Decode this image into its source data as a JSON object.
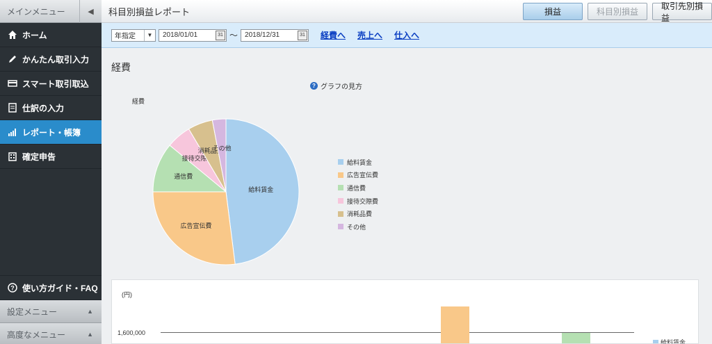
{
  "sidebar": {
    "header": "メインメニュー",
    "items": [
      {
        "label": "ホーム",
        "icon": "home-icon"
      },
      {
        "label": "かんたん取引入力",
        "icon": "pencil-icon"
      },
      {
        "label": "スマート取引取込",
        "icon": "card-icon"
      },
      {
        "label": "仕訳の入力",
        "icon": "document-icon"
      },
      {
        "label": "レポート・帳簿",
        "icon": "chart-icon",
        "active": true
      },
      {
        "label": "確定申告",
        "icon": "building-icon"
      }
    ],
    "help": "使い方ガイド・FAQ",
    "settings_menu": "設定メニュー",
    "advanced_menu": "高度なメニュー"
  },
  "header": {
    "title": "科目別損益レポート",
    "buttons": [
      "損益",
      "科目別損益",
      "取引先別損益"
    ]
  },
  "filter": {
    "period_select": "年指定",
    "date_from": "2018/01/01",
    "date_to": "2018/12/31",
    "tilde": "～",
    "links": [
      "経費へ",
      "売上へ",
      "仕入へ"
    ]
  },
  "main": {
    "section_title": "経費",
    "graph_help": "グラフの見方"
  },
  "chart_data": [
    {
      "type": "pie",
      "title": "経費",
      "categories": [
        "給料賃金",
        "広告宣伝費",
        "通信費",
        "接待交際費",
        "消耗品費",
        "その他"
      ],
      "values": [
        48,
        27,
        11,
        5.5,
        5.5,
        3
      ],
      "colors": [
        "#a8cfee",
        "#f9c889",
        "#b5e0b2",
        "#f7c6dc",
        "#d7c08e",
        "#d5b7e0"
      ],
      "legend_position": "right"
    },
    {
      "type": "bar",
      "ylabel": "(円)",
      "y_ticks": [
        "1,600,000"
      ],
      "legend": [
        "給料賃金"
      ],
      "legend_colors": [
        "#a8cfee"
      ]
    }
  ]
}
